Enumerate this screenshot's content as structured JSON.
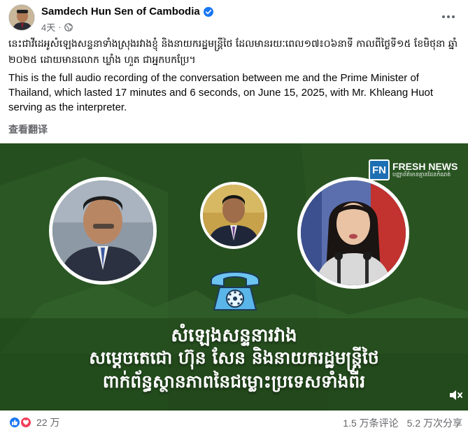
{
  "post": {
    "author": "Samdech Hun Sen of Cambodia",
    "time": "4天",
    "separator": "·",
    "khmer_text": "នេះជាវីដេអូសំឡេងសន្ទនាទាំងស្រុងរវាងខ្ញុំ និងនាយករដ្ឋមន្ត្រីថៃ ដែលមានរយៈពេល១៧៖០៦នាទី កាលពីថ្ងៃទី១៥ ខែមិថុនា ឆ្នាំ២០២៥ ដោយមានលោក ឃ្លាំង ហួត ជាអ្នកបកប្រែ។",
    "english_text": "This is the full audio recording of the conversation between me and the Prime Minister of Thailand, which lasted 17 minutes and 6 seconds, on June 15, 2025, with Mr. Khleang Huot serving as the interpreter.",
    "translate_label": "查看翻译"
  },
  "media": {
    "logo_name": "FRESH NEWS",
    "logo_mark": "FN",
    "logo_tagline": "បញ្ញាព័ត៌មានគ្មានដែនកំណត់",
    "headline_1": "សំឡេងសន្ទនារវាង",
    "headline_2": "សម្តេចតេជោ ហ៊ុន សែន និងនាយករដ្ឋមន្ត្រីថៃ",
    "headline_3": "ពាក់ព័ន្ធស្ថានភាពនៃជម្លោះប្រទេសទាំងពីរ"
  },
  "footer": {
    "reaction_count": "22 万",
    "comments": "1.5 万条评论",
    "shares": "5.2 万次分享"
  },
  "colors": {
    "verified": "#1877f2",
    "like": "#1877f2",
    "love": "#f33e58",
    "media_green": "#2a5222"
  },
  "icons": [
    "verified-badge-icon",
    "globe-icon",
    "more-options-icon",
    "telephone-icon",
    "volume-muted-icon",
    "like-reaction-icon",
    "love-reaction-icon"
  ]
}
